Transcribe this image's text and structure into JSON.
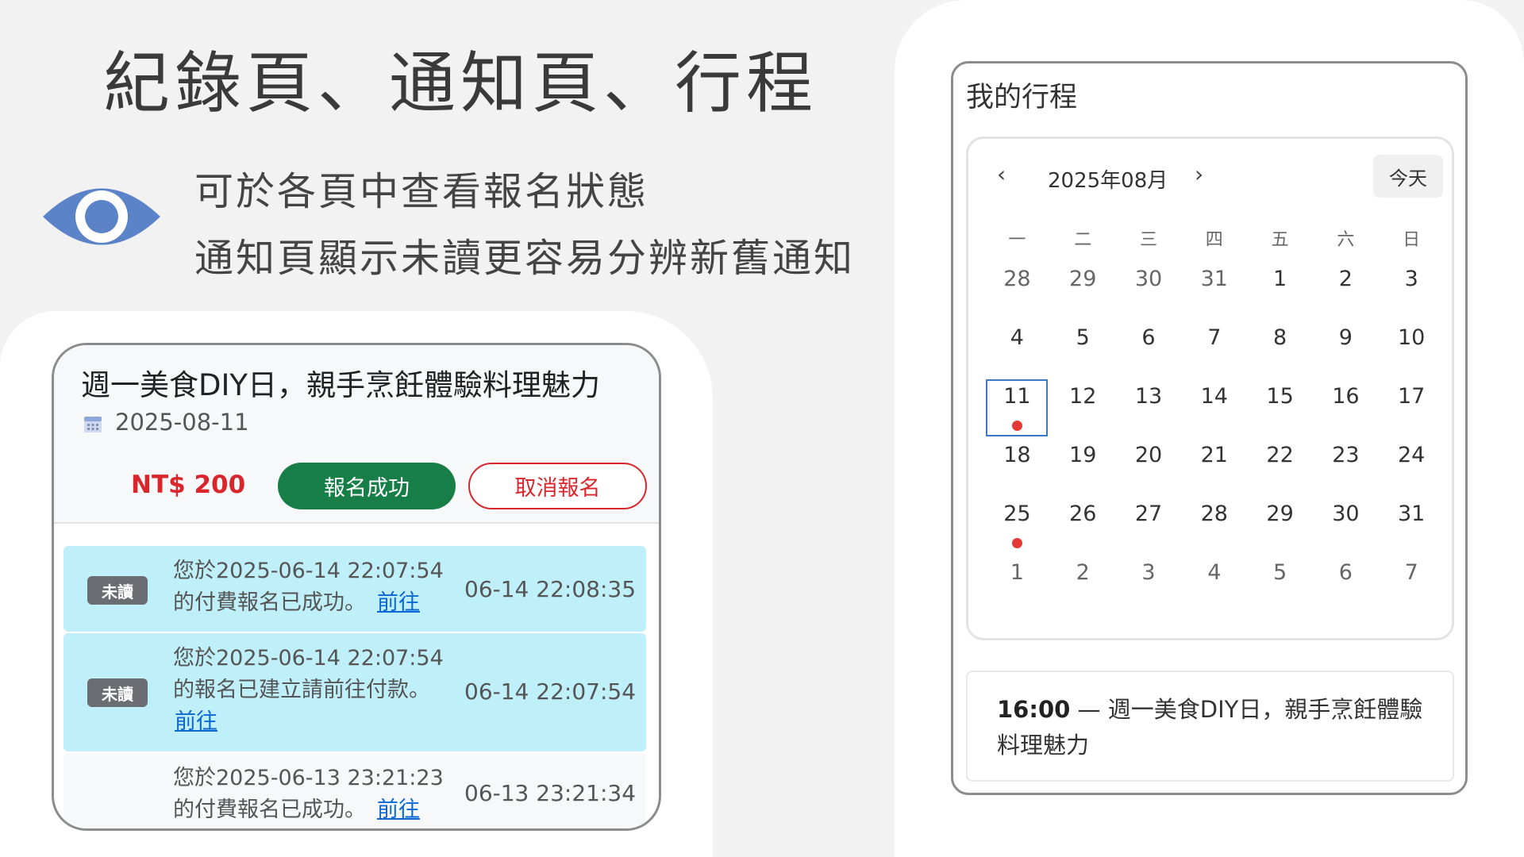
{
  "slide": {
    "title": "紀錄頁、通知頁、行程",
    "desc_line1": "可於各頁中查看報名狀態",
    "desc_line2": "通知頁顯示未讀更容易分辨新舊通知"
  },
  "record": {
    "event_title": "週一美食DIY日，親手烹飪體驗料理魅力",
    "date": "2025-08-11",
    "price": "NT$ 200",
    "status_button": "報名成功",
    "cancel_button": "取消報名"
  },
  "notifications": [
    {
      "badge": "未讀",
      "line1": "您於2025-06-14 22:07:54",
      "line2": "的付費報名已成功。",
      "link": "前往",
      "time": "06-14 22:08:35",
      "unread": true
    },
    {
      "badge": "未讀",
      "line1": "您於2025-06-14 22:07:54",
      "line2": "的報名已建立請前往付款。",
      "link": "前往",
      "time": "06-14 22:07:54",
      "unread": true
    },
    {
      "badge": "",
      "line1": "您於2025-06-13 23:21:23",
      "line2": "的付費報名已成功。",
      "link": "前往",
      "time": "06-13 23:21:34",
      "unread": false
    }
  ],
  "schedule": {
    "title": "我的行程",
    "month_label": "2025年08月",
    "prev": "‹",
    "next": "›",
    "today_button": "今天",
    "weekdays": [
      "一",
      "二",
      "三",
      "四",
      "五",
      "六",
      "日"
    ],
    "weeks": [
      [
        "28",
        "29",
        "30",
        "31",
        "1",
        "2",
        "3"
      ],
      [
        "4",
        "5",
        "6",
        "7",
        "8",
        "9",
        "10"
      ],
      [
        "11",
        "12",
        "13",
        "14",
        "15",
        "16",
        "17"
      ],
      [
        "18",
        "19",
        "20",
        "21",
        "22",
        "23",
        "24"
      ],
      [
        "25",
        "26",
        "27",
        "28",
        "29",
        "30",
        "31"
      ],
      [
        "1",
        "2",
        "3",
        "4",
        "5",
        "6",
        "7"
      ]
    ],
    "selected_day": "11",
    "event_days": [
      "11",
      "25"
    ],
    "event_time": "16:00",
    "event_separator": " — ",
    "event_name": "週一美食DIY日，親手烹飪體驗料理魅力"
  },
  "colors": {
    "accent_green": "#177e48",
    "price_red": "#d9262c",
    "unread_bg": "#bff0f9",
    "eye_icon": "#5b84c8",
    "event_dot": "#e53935"
  }
}
